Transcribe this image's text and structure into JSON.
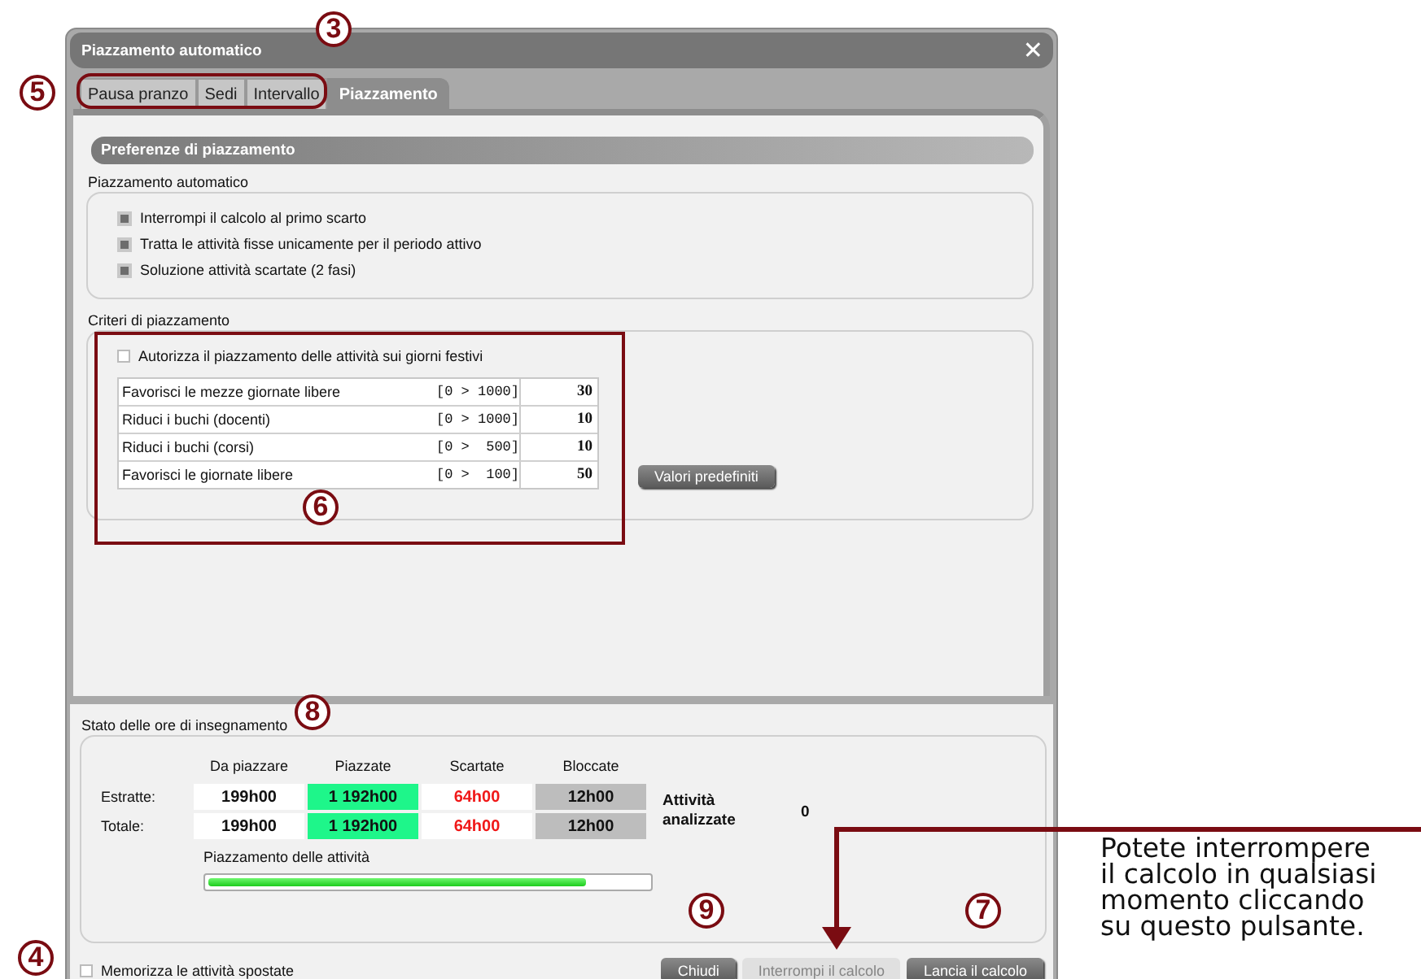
{
  "window": {
    "title": "Piazzamento automatico",
    "close": "✕"
  },
  "tabs": [
    {
      "label": "Pausa pranzo",
      "selected": false
    },
    {
      "label": "Sedi",
      "selected": false
    },
    {
      "label": "Intervallo",
      "selected": false
    },
    {
      "label": "Piazzamento",
      "selected": true
    }
  ],
  "header": "Preferenze di piazzamento",
  "auto_section": {
    "title": "Piazzamento automatico",
    "options": [
      {
        "label": "Interrompi il calcolo al primo scarto",
        "checked": true
      },
      {
        "label": "Tratta le attività fisse unicamente per il periodo attivo",
        "checked": true
      },
      {
        "label": "Soluzione attività scartate (2 fasi)",
        "checked": true
      }
    ]
  },
  "criteria_section": {
    "title": "Criteri di piazzamento",
    "holidays": {
      "label": "Autorizza il piazzamento delle attività sui giorni festivi",
      "checked": false
    },
    "rows": [
      {
        "label": "Favorisci le mezze giornate libere",
        "range": "[0 > 1000]",
        "value": "30"
      },
      {
        "label": "Riduci i buchi (docenti)",
        "range": "[0 > 1000]",
        "value": "10"
      },
      {
        "label": "Riduci i buchi (corsi)",
        "range": "[0 >  500]",
        "value": "10"
      },
      {
        "label": "Favorisci le giornate libere",
        "range": "[0 >  100]",
        "value": "50"
      }
    ],
    "defaults_button": "Valori predefiniti"
  },
  "status": {
    "title": "Stato delle ore di insegnamento",
    "columns": [
      "Da piazzare",
      "Piazzate",
      "Scartate",
      "Bloccate"
    ],
    "rows": [
      {
        "label": "Estratte:",
        "cells": [
          "199h00",
          "1 192h00",
          "64h00",
          "12h00"
        ]
      },
      {
        "label": "Totale:",
        "cells": [
          "199h00",
          "1 192h00",
          "64h00",
          "12h00"
        ]
      }
    ],
    "analyzed_label": "Attività analizzate",
    "analyzed_value": "0",
    "progress": {
      "label": "Piazzamento delle attività",
      "level": 0.86
    }
  },
  "footer": {
    "remember": {
      "label": "Memorizza le attività spostate",
      "checked": false
    },
    "buttons": [
      {
        "label": "Chiudi",
        "disabled": false
      },
      {
        "label": "Interrompi il calcolo",
        "disabled": true
      },
      {
        "label": "Lancia il calcolo",
        "disabled": false
      }
    ]
  },
  "annotations": [
    {
      "number": "3"
    },
    {
      "number": "5"
    },
    {
      "number": "6"
    },
    {
      "number": "8"
    },
    {
      "number": "9"
    },
    {
      "number": "7"
    },
    {
      "number": "4"
    }
  ],
  "callout": "Potete interrompere il calcolo in qualsiasi momento cliccando su questo pulsante."
}
